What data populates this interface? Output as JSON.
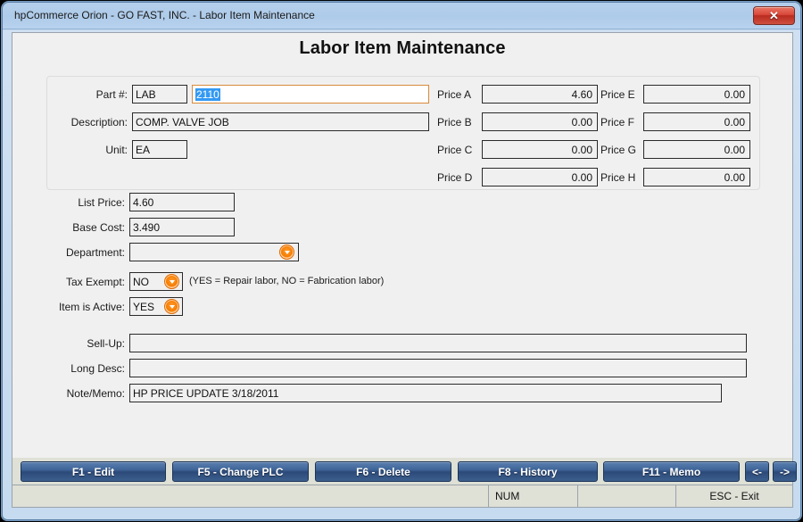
{
  "window": {
    "title": "hpCommerce Orion - GO FAST, INC. - Labor Item Maintenance",
    "close_label": "✕"
  },
  "page": {
    "title": "Labor Item Maintenance"
  },
  "item_group": {
    "part_label": "Part #:",
    "part_prefix": "LAB",
    "part_number": "2110",
    "description_label": "Description:",
    "description": "COMP. VALVE JOB",
    "unit_label": "Unit:",
    "unit": "EA",
    "prices_left": [
      {
        "label": "Price A",
        "value": "4.60"
      },
      {
        "label": "Price B",
        "value": "0.00"
      },
      {
        "label": "Price C",
        "value": "0.00"
      },
      {
        "label": "Price D",
        "value": "0.00"
      }
    ],
    "prices_right": [
      {
        "label": "Price E",
        "value": "0.00"
      },
      {
        "label": "Price F",
        "value": "0.00"
      },
      {
        "label": "Price G",
        "value": "0.00"
      },
      {
        "label": "Price H",
        "value": "0.00"
      }
    ]
  },
  "details": {
    "list_price_label": "List Price:",
    "list_price": "4.60",
    "base_cost_label": "Base Cost:",
    "base_cost": "3.490",
    "department_label": "Department:",
    "department": "",
    "tax_exempt_label": "Tax Exempt:",
    "tax_exempt": "NO",
    "tax_exempt_hint": "(YES = Repair labor, NO = Fabrication labor)",
    "item_active_label": "Item is Active:",
    "item_active": "YES"
  },
  "notes": {
    "sell_up_label": "Sell-Up:",
    "sell_up": "",
    "long_desc_label": "Long Desc:",
    "long_desc": "",
    "note_memo_label": "Note/Memo:",
    "note_memo": "HP PRICE UPDATE 3/18/2011"
  },
  "buttons": [
    {
      "label": "F1 - Edit"
    },
    {
      "label": "F5 - Change PLC"
    },
    {
      "label": "F6 - Delete"
    },
    {
      "label": "F8 - History"
    },
    {
      "label": "F11 - Memo"
    },
    {
      "label": "<-"
    },
    {
      "label": "->"
    }
  ],
  "statusbar": {
    "message": "",
    "num": "NUM",
    "middle": "",
    "esc": "ESC - Exit"
  },
  "colors": {
    "titlebar": "#b4cfec",
    "close": "#c0392b",
    "button": "#2c4a79",
    "dropdown": "#f57c00",
    "selection": "#3399f3",
    "focus_border": "#d98a3a",
    "statusbar": "#dfe0d6"
  }
}
